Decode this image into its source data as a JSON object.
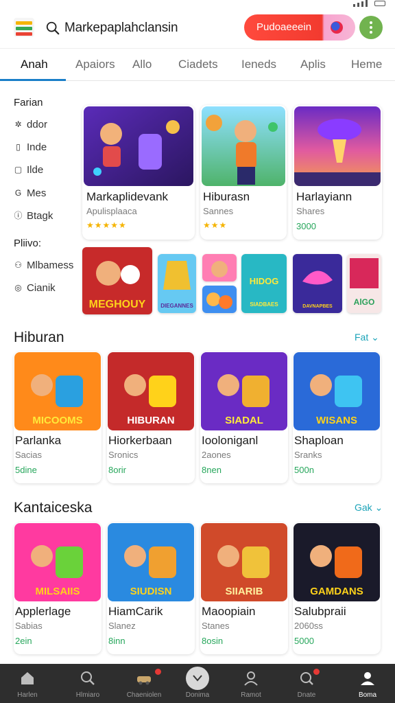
{
  "header": {
    "search_text": "Markepaplahclansin",
    "promo_label": "Pudoaeeein"
  },
  "tabs": [
    {
      "label": "Anah",
      "active": true
    },
    {
      "label": "Apaiors",
      "active": false
    },
    {
      "label": "Allo",
      "active": false
    },
    {
      "label": "Ciadets",
      "active": false
    },
    {
      "label": "Ieneds",
      "active": false
    },
    {
      "label": "Aplis",
      "active": false
    },
    {
      "label": "Heme",
      "active": false
    }
  ],
  "sidebar": {
    "heading1": "Farian",
    "items1": [
      {
        "label": "ddor",
        "icon": "sparkle-icon"
      },
      {
        "label": "Inde",
        "icon": "bookmark-icon"
      },
      {
        "label": "Ilde",
        "icon": "square-icon"
      },
      {
        "label": "Mes",
        "icon": "circle-g-icon"
      },
      {
        "label": "Btagk",
        "icon": "info-icon"
      }
    ],
    "heading2": "Pliivo:",
    "items2": [
      {
        "label": "Mlbamess",
        "icon": "person-icon"
      },
      {
        "label": "Cianik",
        "icon": "circle-icon"
      }
    ]
  },
  "featured": [
    {
      "title": "Markaplidevank",
      "sub": "Apulisplaaca",
      "meta": "★★★★★"
    },
    {
      "title": "Hiburasn",
      "sub": "Sannes",
      "meta": "★★★"
    },
    {
      "title": "Harlayiann",
      "sub": "Shares",
      "meta": "3000"
    }
  ],
  "strip_labels": [
    "MEGHOUY",
    "DIEGANNES",
    "SIADBAES",
    "DAVNAPBES",
    "AlGO"
  ],
  "sections": [
    {
      "title": "Hiburan",
      "more": "Fat ⌄",
      "cards": [
        {
          "title": "Parlanka",
          "sub": "Sacias",
          "meta": "5dine",
          "art": "MICOOMS"
        },
        {
          "title": "Hiorkerbaan",
          "sub": "Sronics",
          "meta": "8orir",
          "art": "HIBURAN"
        },
        {
          "title": "Iooloniganl",
          "sub": "2aones",
          "meta": "8nen",
          "art": "SIADAL"
        },
        {
          "title": "Shaploan",
          "sub": "Sranks",
          "meta": "500n",
          "art": "WISANS"
        }
      ]
    },
    {
      "title": "Kantaiceska",
      "more": "Gak ⌄",
      "cards": [
        {
          "title": "Applerlage",
          "sub": "Sabias",
          "meta": "2ein",
          "art": "MILSAIIS"
        },
        {
          "title": "HiamCarik",
          "sub": "Slanez",
          "meta": "8inn",
          "art": "SIUDISN"
        },
        {
          "title": "Maoopiain",
          "sub": "Stanes",
          "meta": "8osin",
          "art": "SIIARIB"
        },
        {
          "title": "Salubpraii",
          "sub": "2060ss",
          "meta": "5000",
          "art": "GAMDANS"
        }
      ]
    }
  ],
  "bottom_nav": [
    {
      "label": "Harlen",
      "icon": "home-icon",
      "active": false
    },
    {
      "label": "Hlmiaro",
      "icon": "search-icon",
      "active": false
    },
    {
      "label": "Chaeniolen",
      "icon": "car-icon",
      "active": false
    },
    {
      "label": "Donima",
      "icon": "chevron-icon",
      "active": false
    },
    {
      "label": "Ramot",
      "icon": "user-outline-icon",
      "active": false
    },
    {
      "label": "Dnate",
      "icon": "notifications-icon",
      "active": false
    },
    {
      "label": "Boma",
      "icon": "profile-icon",
      "active": true
    }
  ]
}
